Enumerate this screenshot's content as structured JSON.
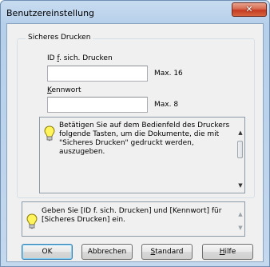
{
  "window": {
    "title": "Benutzereinstellung",
    "close_symbol": "✕"
  },
  "group": {
    "legend": "Sicheres Drucken",
    "id_label": {
      "pre": "ID ",
      "underlined": "f",
      "post": ". sich. Drucken"
    },
    "id_value": "",
    "id_max": "Max. 16",
    "password_label": {
      "underlined": "K",
      "post": "ennwort"
    },
    "password_value": "",
    "password_max": "Max. 8",
    "info_text": "Betätigen Sie auf dem Bedienfeld des Druckers folgende Tasten, um die Dokumente, die mit \"Sicheres Drucken\" gedruckt werden, auszugeben."
  },
  "hint": {
    "text": "Geben Sie [ID f. sich. Drucken] und [Kennwort] für [Sicheres Drucken] ein."
  },
  "buttons": {
    "ok": "OK",
    "cancel": "Abbrechen",
    "standard": {
      "underlined": "S",
      "post": "tandard"
    },
    "help": {
      "underlined": "H",
      "post": "ilfe"
    }
  },
  "icons": {
    "info_bulb": "lightbulb-icon",
    "scroll_up": "chevron-up-icon",
    "scroll_down": "chevron-down-icon",
    "close": "close-icon"
  }
}
